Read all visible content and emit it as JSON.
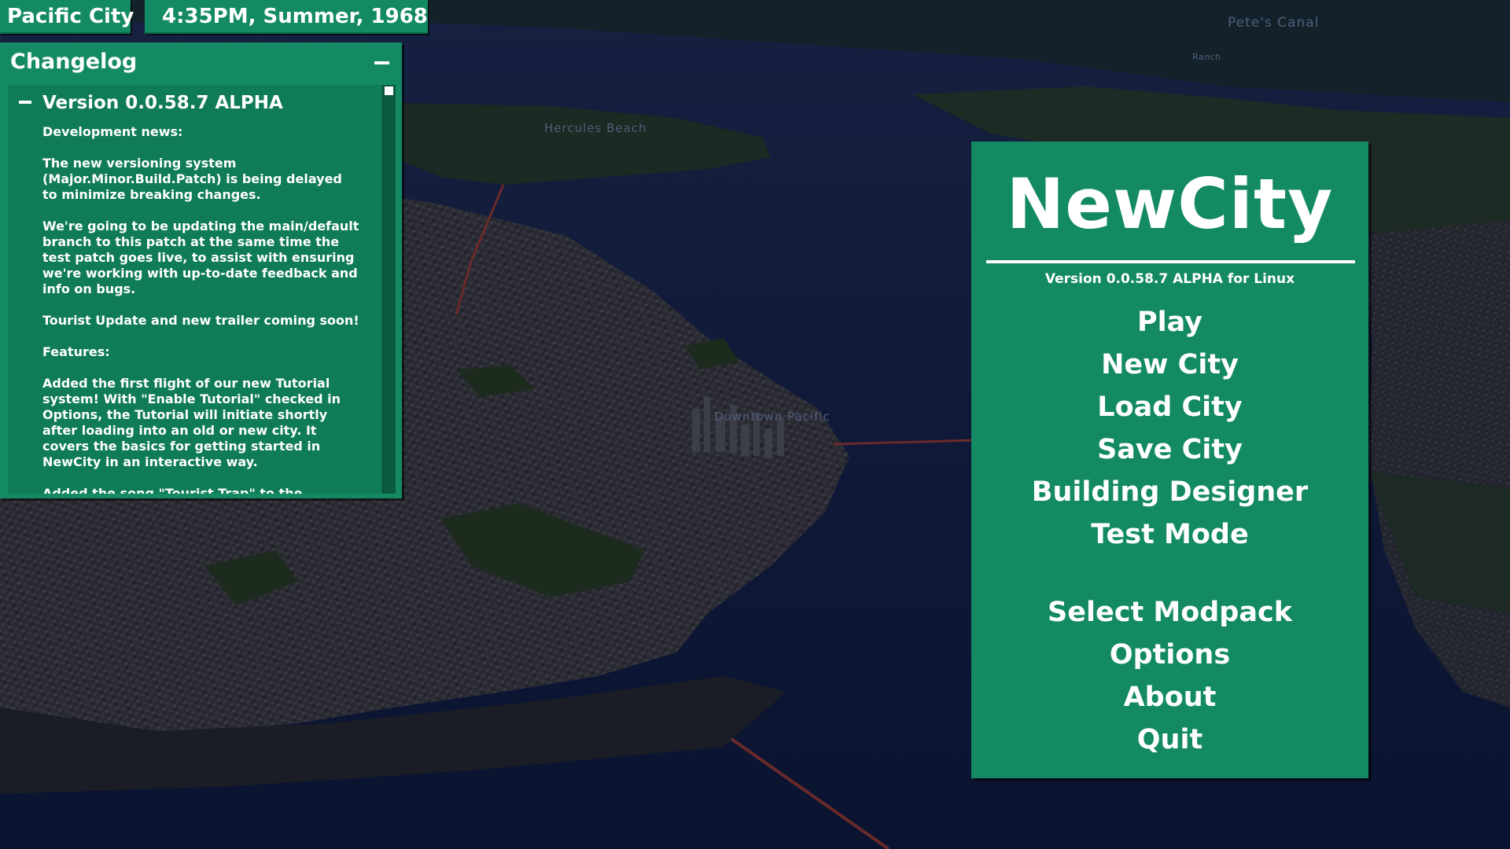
{
  "hud": {
    "city_name": "Pacific City",
    "datetime": "4:35PM, Summer, 1968"
  },
  "map_labels": {
    "canal": "Pete's Canal",
    "ranch": "Ranch",
    "beach": "Hercules Beach",
    "downtown": "Downtown Pacific"
  },
  "changelog": {
    "title": "Changelog",
    "version_heading": "Version 0.0.58.7 ALPHA",
    "paragraphs": [
      "Development news:",
      "The new versioning system\n(Major.Minor.Build.Patch) is being delayed\nto minimize breaking changes.",
      "We're going to be updating the main/default\nbranch to this patch at the same time the\ntest patch goes live, to assist with ensuring\nwe're working with up-to-date feedback and\ninfo on bugs.",
      "Tourist Update and new trailer coming soon!",
      "Features:",
      "Added the first flight of our new Tutorial\nsystem! With \"Enable Tutorial\" checked in\nOptions, the Tutorial will initiate shortly\nafter loading into an old or new city. It\ncovers the basics for getting started in\nNewCity in an interactive way.",
      "Added the song \"Tourist Trap\" to the"
    ]
  },
  "menu": {
    "logo": "NewCity",
    "version": "Version 0.0.58.7 ALPHA for Linux",
    "items": [
      "Play",
      "New City",
      "Load City",
      "Save City",
      "Building Designer",
      "Test Mode",
      "Select Modpack",
      "Options",
      "About",
      "Quit"
    ]
  },
  "colors": {
    "panel": "#138a63",
    "panel_dark": "#0f7b57",
    "ocean": "#0b1535",
    "text": "#ffffff"
  }
}
